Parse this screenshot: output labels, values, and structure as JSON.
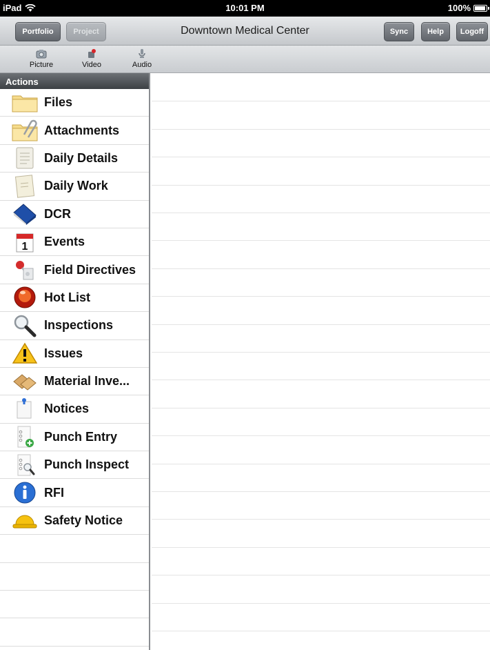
{
  "status_bar": {
    "device": "iPad",
    "time": "10:01 PM",
    "battery": "100%",
    "battery_level": 1.0
  },
  "nav_bar": {
    "title": "Downtown Medical Center",
    "portfolio_label": "Portfolio",
    "project_label": "Project",
    "sync_label": "Sync",
    "help_label": "Help",
    "logoff_label": "Logoff"
  },
  "media_bar": {
    "items": [
      {
        "label": "Picture",
        "icon": "camera-icon"
      },
      {
        "label": "Video",
        "icon": "video-icon"
      },
      {
        "label": "Audio",
        "icon": "microphone-icon"
      }
    ]
  },
  "sidebar": {
    "header": "Actions",
    "items": [
      {
        "label": "Files",
        "icon": "folder-icon"
      },
      {
        "label": "Attachments",
        "icon": "paperclip-folder-icon"
      },
      {
        "label": "Daily Details",
        "icon": "notepad-icon"
      },
      {
        "label": "Daily Work",
        "icon": "note-page-icon"
      },
      {
        "label": "DCR",
        "icon": "book-icon"
      },
      {
        "label": "Events",
        "icon": "calendar-icon"
      },
      {
        "label": "Field Directives",
        "icon": "pin-icon"
      },
      {
        "label": "Hot List",
        "icon": "red-light-icon"
      },
      {
        "label": "Inspections",
        "icon": "magnifier-icon"
      },
      {
        "label": "Issues",
        "icon": "warning-icon"
      },
      {
        "label": "Material Inve...",
        "icon": "boxes-icon"
      },
      {
        "label": "Notices",
        "icon": "pinned-note-icon"
      },
      {
        "label": "Punch Entry",
        "icon": "list-add-icon"
      },
      {
        "label": "Punch Inspect",
        "icon": "list-magnifier-icon"
      },
      {
        "label": "RFI",
        "icon": "info-icon"
      },
      {
        "label": "Safety Notice",
        "icon": "hard-hat-icon"
      }
    ]
  },
  "colors": {
    "nav_button": "#6a6e74",
    "sidebar_header": "#4a4e52",
    "divider": "#dcdcdc"
  }
}
